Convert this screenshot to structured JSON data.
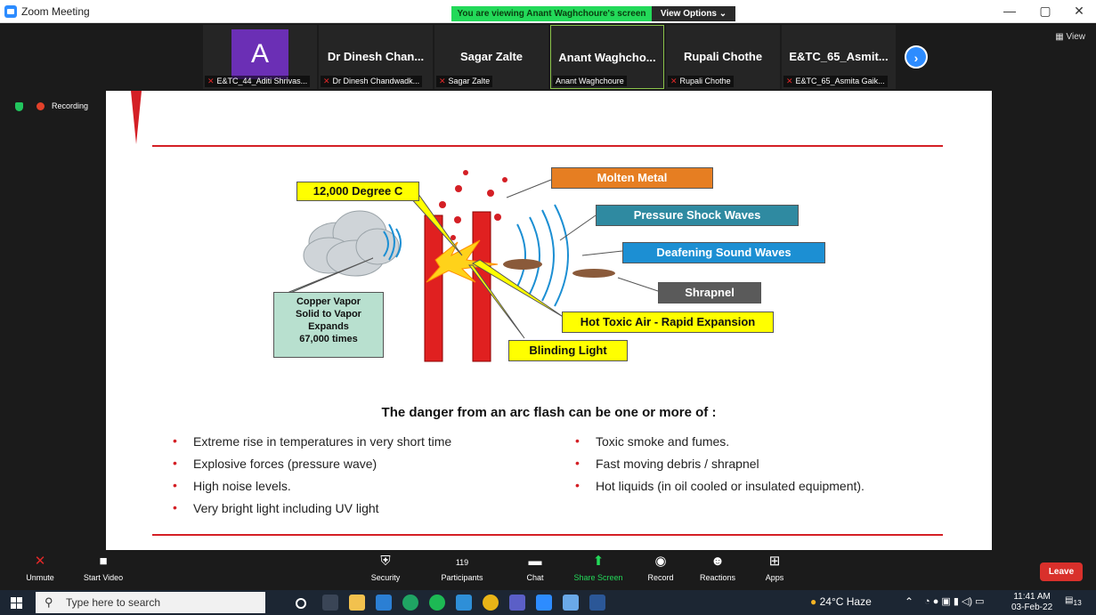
{
  "window": {
    "title": "Zoom Meeting",
    "minimize": "—",
    "restore": "▢",
    "close": "✕"
  },
  "share_banner": {
    "text": "You are viewing Anant Waghchoure's screen",
    "view_options": "View Options ⌄"
  },
  "participants": [
    {
      "name": "",
      "avatar_letter": "A",
      "caption": "E&TC_44_Aditi Shrivas...",
      "muted": true
    },
    {
      "name": "Dr Dinesh Chan...",
      "caption": "Dr Dinesh Chandwadk...",
      "muted": true
    },
    {
      "name": "Sagar Zalte",
      "caption": "Sagar Zalte",
      "muted": true
    },
    {
      "name": "Anant Waghcho...",
      "caption": "Anant Waghchoure",
      "muted": false,
      "active": true
    },
    {
      "name": "Rupali Chothe",
      "caption": "Rupali Chothe",
      "muted": true
    },
    {
      "name": "E&TC_65_Asmit...",
      "caption": "E&TC_65_Asmita Gaik...",
      "muted": true
    }
  ],
  "view_button": "View",
  "recording": {
    "label": "Recording"
  },
  "slide": {
    "diagram_labels": {
      "temperature": "12,000 Degree C",
      "molten_metal": "Molten Metal",
      "pressure_waves": "Pressure Shock Waves",
      "sound_waves": "Deafening Sound Waves",
      "shrapnel": "Shrapnel",
      "hot_air": "Hot Toxic Air - Rapid Expansion",
      "blinding_light": "Blinding Light",
      "copper_vapor": [
        "Copper Vapor",
        "Solid to Vapor",
        "Expands",
        "67,000 times"
      ]
    },
    "heading": "The danger from an arc flash can be one or more of :",
    "bullets_left": [
      "Extreme rise in temperatures in very short time",
      "Explosive forces (pressure wave)",
      "High noise levels.",
      "Very bright light including UV light"
    ],
    "bullets_right": [
      "Toxic smoke and fumes.",
      "Fast moving debris / shrapnel",
      "Hot liquids (in oil cooled or insulated equipment)."
    ],
    "accent_color": "#d41f25"
  },
  "toolbar": {
    "unmute": "Unmute",
    "start_video": "Start Video",
    "security": "Security",
    "participants": "Participants",
    "participants_count": "119",
    "chat": "Chat",
    "share_screen": "Share Screen",
    "record": "Record",
    "reactions": "Reactions",
    "apps": "Apps",
    "leave": "Leave"
  },
  "taskbar": {
    "search_placeholder": "Type here to search",
    "weather": "24°C Haze",
    "time": "11:41 AM",
    "date": "03-Feb-22",
    "notifications": "13"
  }
}
